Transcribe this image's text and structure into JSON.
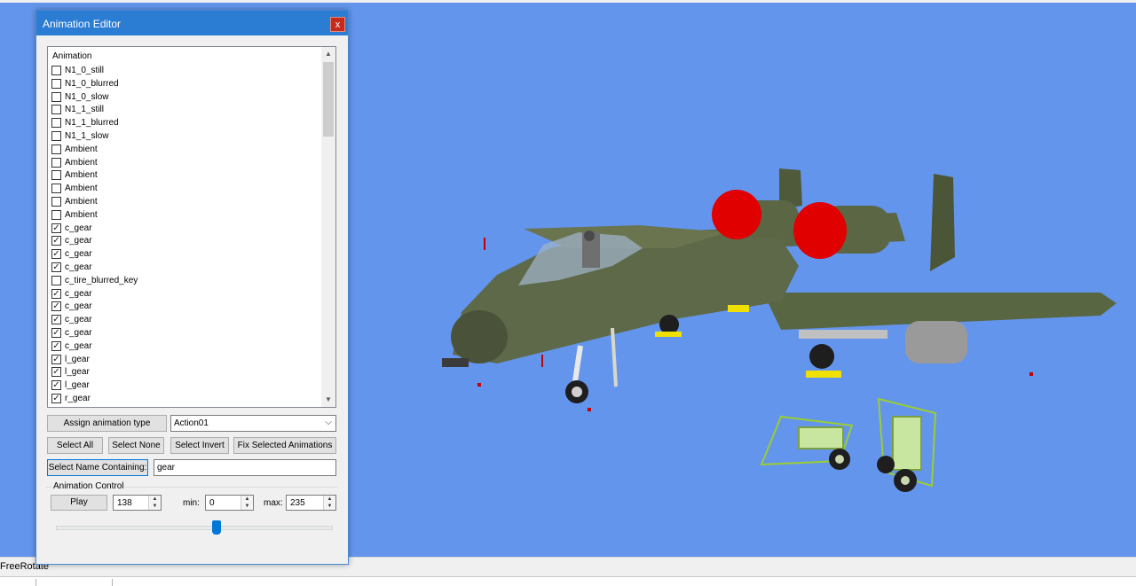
{
  "dialog": {
    "title": "Animation Editor",
    "close_label": "x",
    "list_header": "Animation",
    "items": [
      {
        "label": "N1_0_still",
        "checked": false
      },
      {
        "label": "N1_0_blurred",
        "checked": false
      },
      {
        "label": "N1_0_slow",
        "checked": false
      },
      {
        "label": "N1_1_still",
        "checked": false
      },
      {
        "label": "N1_1_blurred",
        "checked": false
      },
      {
        "label": "N1_1_slow",
        "checked": false
      },
      {
        "label": "Ambient",
        "checked": false
      },
      {
        "label": "Ambient",
        "checked": false
      },
      {
        "label": "Ambient",
        "checked": false
      },
      {
        "label": "Ambient",
        "checked": false
      },
      {
        "label": "Ambient",
        "checked": false
      },
      {
        "label": "Ambient",
        "checked": false
      },
      {
        "label": "c_gear",
        "checked": true
      },
      {
        "label": "c_gear",
        "checked": true
      },
      {
        "label": "c_gear",
        "checked": true
      },
      {
        "label": "c_gear",
        "checked": true
      },
      {
        "label": "c_tire_blurred_key",
        "checked": false
      },
      {
        "label": "c_gear",
        "checked": true
      },
      {
        "label": "c_gear",
        "checked": true
      },
      {
        "label": "c_gear",
        "checked": true
      },
      {
        "label": "c_gear",
        "checked": true
      },
      {
        "label": "c_gear",
        "checked": true
      },
      {
        "label": "l_gear",
        "checked": true
      },
      {
        "label": "l_gear",
        "checked": true
      },
      {
        "label": "l_gear",
        "checked": true
      },
      {
        "label": "r_gear",
        "checked": true
      }
    ],
    "assign_button": "Assign animation type",
    "action_combo_value": "Action01",
    "select_all": "Select All",
    "select_none": "Select None",
    "select_invert": "Select Invert",
    "fix_selected": "Fix Selected Animations",
    "select_name_button": "Select Name Containing:",
    "name_filter_value": "gear",
    "animation_control_label": "Animation Control",
    "play_button": "Play",
    "frame_value": "138",
    "min_label": "min:",
    "min_value": "0",
    "max_label": "max:",
    "max_value": "235",
    "slider_position_fraction": 0.587
  },
  "status": {
    "text": "FreeRotate"
  },
  "colors": {
    "viewport_background": "#6495ed",
    "titlebar": "#2b7cd3",
    "close_button": "#c42b1c",
    "accent": "#0078d7"
  }
}
